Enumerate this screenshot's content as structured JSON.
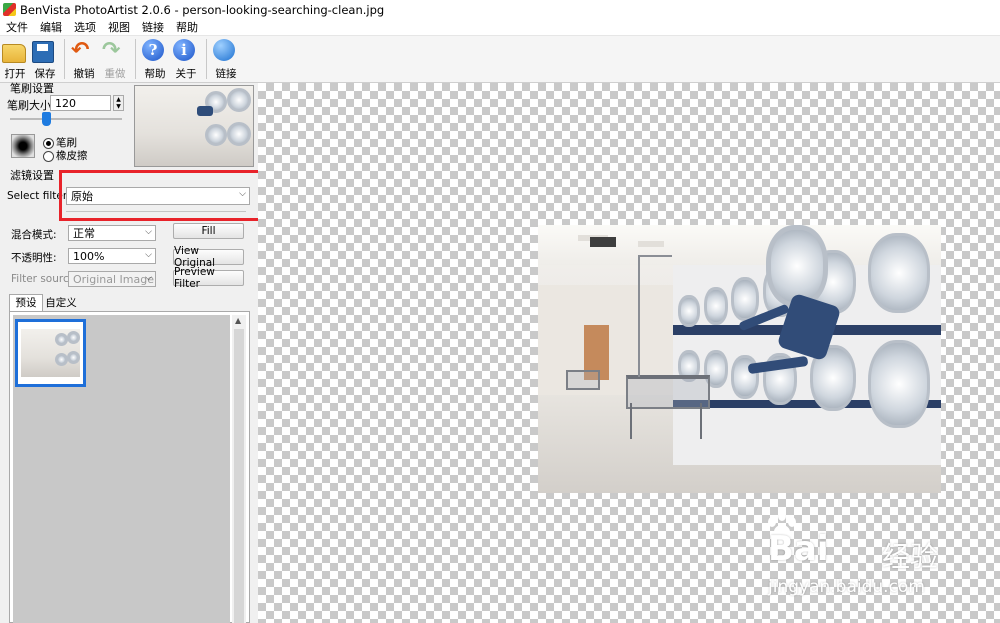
{
  "window": {
    "title": "BenVista PhotoArtist 2.0.6 - person-looking-searching-clean.jpg"
  },
  "menu": [
    "文件",
    "编辑",
    "选项",
    "视图",
    "链接",
    "帮助"
  ],
  "toolbar": {
    "open": "打开",
    "save": "保存",
    "undo": "撤销",
    "redo": "重做",
    "help": "帮助",
    "about": "关于",
    "link": "链接",
    "help_glyph": "?",
    "about_glyph": "i"
  },
  "brush": {
    "section_title": "笔刷设置",
    "size_label": "笔刷大小:",
    "size_value": "120",
    "mode_brush": "笔刷",
    "mode_eraser": "橡皮擦",
    "selected_mode": "笔刷"
  },
  "filter": {
    "section_title": "滤镜设置",
    "select_label": "Select filter",
    "selected": "原始",
    "blend_label": "混合模式:",
    "blend_value": "正常",
    "opacity_label": "不透明性:",
    "opacity_value": "100%",
    "source_label": "Filter source:",
    "source_value": "Original Image",
    "fill_button": "Fill",
    "view_original_button": "View Original",
    "preview_button": "Preview Filter"
  },
  "tabs": {
    "presets": "预设",
    "custom": "自定义",
    "active": "预设"
  },
  "colors": {
    "highlight_box": "#e8232a",
    "selection_blue": "#1e6fd9"
  },
  "watermark": {
    "brand": "Bai",
    "brand2": "经验",
    "url": "jingyan.baidu.com"
  }
}
